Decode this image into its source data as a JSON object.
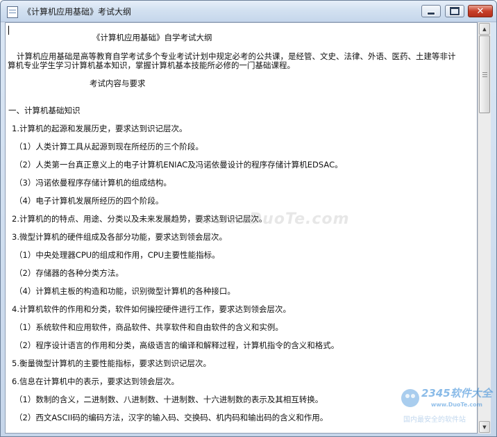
{
  "window": {
    "title": "《计算机应用基础》考试大纲",
    "controls": {
      "minimize": "minimize",
      "maximize": "maximize",
      "close": "✕"
    }
  },
  "document": {
    "heading": "《计算机应用基础》自学考试大纲",
    "intro_line1": "计算机应用基础是高等教育自学考试多个专业考试计划中规定必考的公共课，是经管、文史、法律、外语、医药、土建等非计",
    "intro_line2": "算机专业学生学习计算机基本知识，掌握计算机基本技能所必修的一门基础课程。",
    "section_title": "考试内容与要求",
    "part1": "一、计算机基础知识",
    "lines": [
      "1.计算机的起源和发展历史，要求达到识记层次。",
      "（1）人类计算工具从起源到现在所经历的三个阶段。",
      "（2）人类第一台真正意义上的电子计算机ENIAC及冯诺依曼设计的程序存储计算机EDSAC。",
      "（3）冯诺依曼程序存储计算机的组成结构。",
      "（4）电子计算机发展所经历的四个阶段。",
      "2.计算机的的特点、用途、分类以及未来发展趋势，要求达到识记层次。",
      "3.微型计算机的硬件组成及各部分功能，要求达到领会层次。",
      "（1）中央处理器CPU的组成和作用，CPU主要性能指标。",
      "（2）存储器的各种分类方法。",
      "（4）计算机主板的构造和功能，识别微型计算机的各种接口。",
      "4.计算机软件的作用和分类，软件如何操控硬件进行工作，要求达到领会层次。",
      "（1）系统软件和应用软件，商品软件、共享软件和自由软件的含义和实例。",
      "（2）程序设计语言的作用和分类，高级语言的编译和解释过程，计算机指令的含义和格式。",
      "5.衡量微型计算机的主要性能指标，要求达到识记层次。",
      "6.信息在计算机中的表示，要求达到领会层次。",
      "（1）数制的含义，二进制数、八进制数、十进制数、十六进制数的表示及其相互转换。",
      "（2）西文ASCII码的编码方法，汉字的输入码、交换码、机内码和输出码的含义和作用。"
    ]
  },
  "watermarks": {
    "center": "www.DuoTe.com",
    "corner_brand": "2345软件大全",
    "corner_url": "www.DuoTe.com",
    "corner_tagline": "国内最安全的软件站"
  },
  "colors": {
    "close_button": "#c7402a",
    "titlebar": "#d3e1f1",
    "logo_blue": "#2f86d6",
    "logo_orange": "#f39a1e"
  }
}
